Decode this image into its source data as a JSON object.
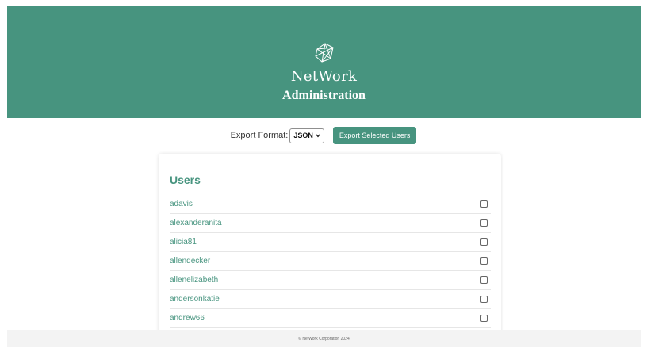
{
  "header": {
    "brand": "NetWork",
    "subtitle": "Administration",
    "logo_icon": "network-polygon-icon"
  },
  "export": {
    "label": "Export Format:",
    "format_selected": "JSON",
    "button_label": "Export Selected Users"
  },
  "users": {
    "title": "Users",
    "items": [
      {
        "username": "adavis",
        "checked": false
      },
      {
        "username": "alexanderanita",
        "checked": false
      },
      {
        "username": "alicia81",
        "checked": false
      },
      {
        "username": "allendecker",
        "checked": false
      },
      {
        "username": "allenelizabeth",
        "checked": false
      },
      {
        "username": "andersonkatie",
        "checked": false
      },
      {
        "username": "andrew66",
        "checked": false
      }
    ]
  },
  "footer": {
    "text": "© NetWork Corporation 2024"
  },
  "colors": {
    "accent": "#47947f",
    "footer_bg": "#f3f3f3"
  }
}
